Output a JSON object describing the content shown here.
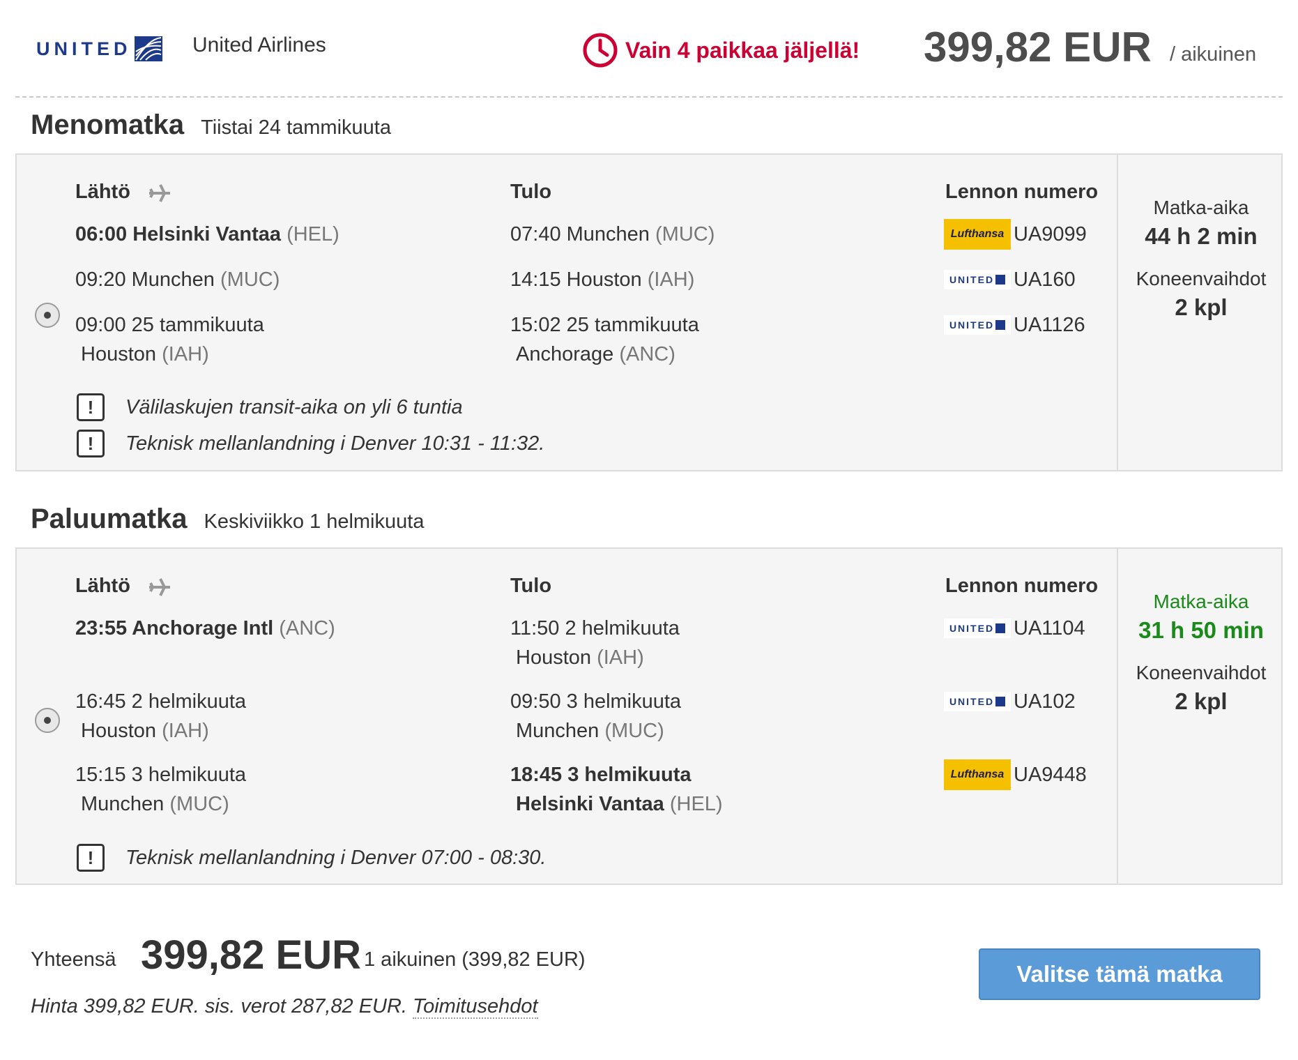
{
  "header": {
    "airline_logo_text": "UNITED",
    "airline_name": "United Airlines",
    "urgency_text": "Vain 4 paikkaa jäljellä!",
    "price": "399,82 EUR",
    "per_adult": "/ aikuinen",
    "accent_color": "#cc0033"
  },
  "columns": {
    "departure": "Lähtö",
    "arrival": "Tulo",
    "flight_number": "Lennon numero"
  },
  "outbound": {
    "title": "Menomatka",
    "date": "Tiistai 24 tammikuuta",
    "legs": [
      {
        "dep_time": "06:00 Helsinki Vantaa",
        "dep_code": "(HEL)",
        "arr_time": "07:40 Munchen",
        "arr_code": "(MUC)",
        "carrier": "Lufthansa",
        "flight": "UA9099"
      },
      {
        "dep_time": "09:20 Munchen",
        "dep_code": "(MUC)",
        "arr_time": "14:15 Houston",
        "arr_code": "(IAH)",
        "carrier": "United",
        "flight": "UA160"
      },
      {
        "dep_time": "09:00 25 tammikuuta",
        "dep_city": "Houston",
        "dep_code": "(IAH)",
        "arr_time": "15:02 25 tammikuuta",
        "arr_city": "Anchorage",
        "arr_code": "(ANC)",
        "carrier": "United",
        "flight": "UA1126"
      }
    ],
    "notes": [
      "Välilaskujen transit-aika on yli 6 tuntia",
      "Teknisk mellanlandning i Denver 10:31 - 11:32."
    ],
    "duration_label": "Matka-aika",
    "duration": "44 h 2 min",
    "changes_label": "Koneenvaihdot",
    "changes": "2 kpl"
  },
  "return": {
    "title": "Paluumatka",
    "date": "Keskiviikko 1 helmikuuta",
    "legs": [
      {
        "dep_time": "23:55 Anchorage Intl",
        "dep_code": "(ANC)",
        "arr_time": "11:50 2 helmikuuta",
        "arr_city": "Houston",
        "arr_code": "(IAH)",
        "carrier": "United",
        "flight": "UA1104"
      },
      {
        "dep_time": "16:45 2 helmikuuta",
        "dep_city": "Houston",
        "dep_code": "(IAH)",
        "arr_time": "09:50 3 helmikuuta",
        "arr_city": "Munchen",
        "arr_code": "(MUC)",
        "carrier": "United",
        "flight": "UA102"
      },
      {
        "dep_time": "15:15 3 helmikuuta",
        "dep_city": "Munchen",
        "dep_code": "(MUC)",
        "arr_time": "18:45 3 helmikuuta",
        "arr_city": "Helsinki Vantaa",
        "arr_code": "(HEL)",
        "carrier": "Lufthansa",
        "flight": "UA9448"
      }
    ],
    "notes": [
      "Teknisk mellanlandning i Denver 07:00 - 08:30."
    ],
    "duration_label": "Matka-aika",
    "duration": "31 h 50 min",
    "duration_color": "#1a8a1a",
    "changes_label": "Koneenvaihdot",
    "changes": "2 kpl"
  },
  "logos": {
    "lufthansa": "Lufthansa",
    "united": "UNITED"
  },
  "footer": {
    "total_label": "Yhteensä",
    "total_price": "399,82 EUR",
    "total_detail": "1 aikuinen (399,82 EUR)",
    "price_note": "Hinta 399,82 EUR. sis. verot 287,82 EUR.",
    "terms_link": "Toimitusehdot",
    "select_button": "Valitse tämä matka",
    "button_color": "#5b9bd8"
  },
  "icons": {
    "clock": "clock-icon",
    "plane": "plane-icon",
    "warning": "warning-icon",
    "radio": "radio-selected-icon"
  }
}
